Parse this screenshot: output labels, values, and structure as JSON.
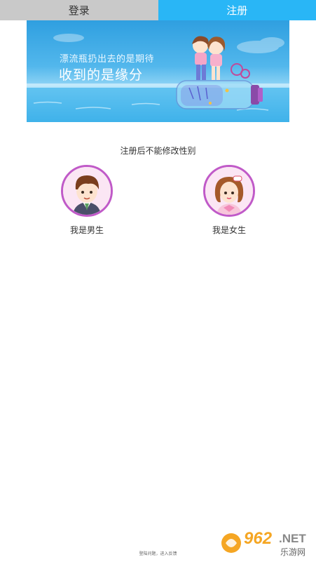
{
  "tabs": {
    "login": "登录",
    "register": "注册",
    "active": "register"
  },
  "banner": {
    "line1": "漂流瓶扔出去的是期待",
    "line2": "收到的是缘分"
  },
  "notice": "注册后不能修改性别",
  "gender_options": {
    "male": "我是男生",
    "female": "我是女生"
  },
  "footer": "登陆问题，进入反馈",
  "watermark": {
    "number": "962",
    "suffix": ".NET",
    "cn": "乐游网"
  },
  "colors": {
    "active_tab": "#29b6f6",
    "inactive_tab": "#c9c9c9",
    "avatar_border": "#c05ac8"
  }
}
